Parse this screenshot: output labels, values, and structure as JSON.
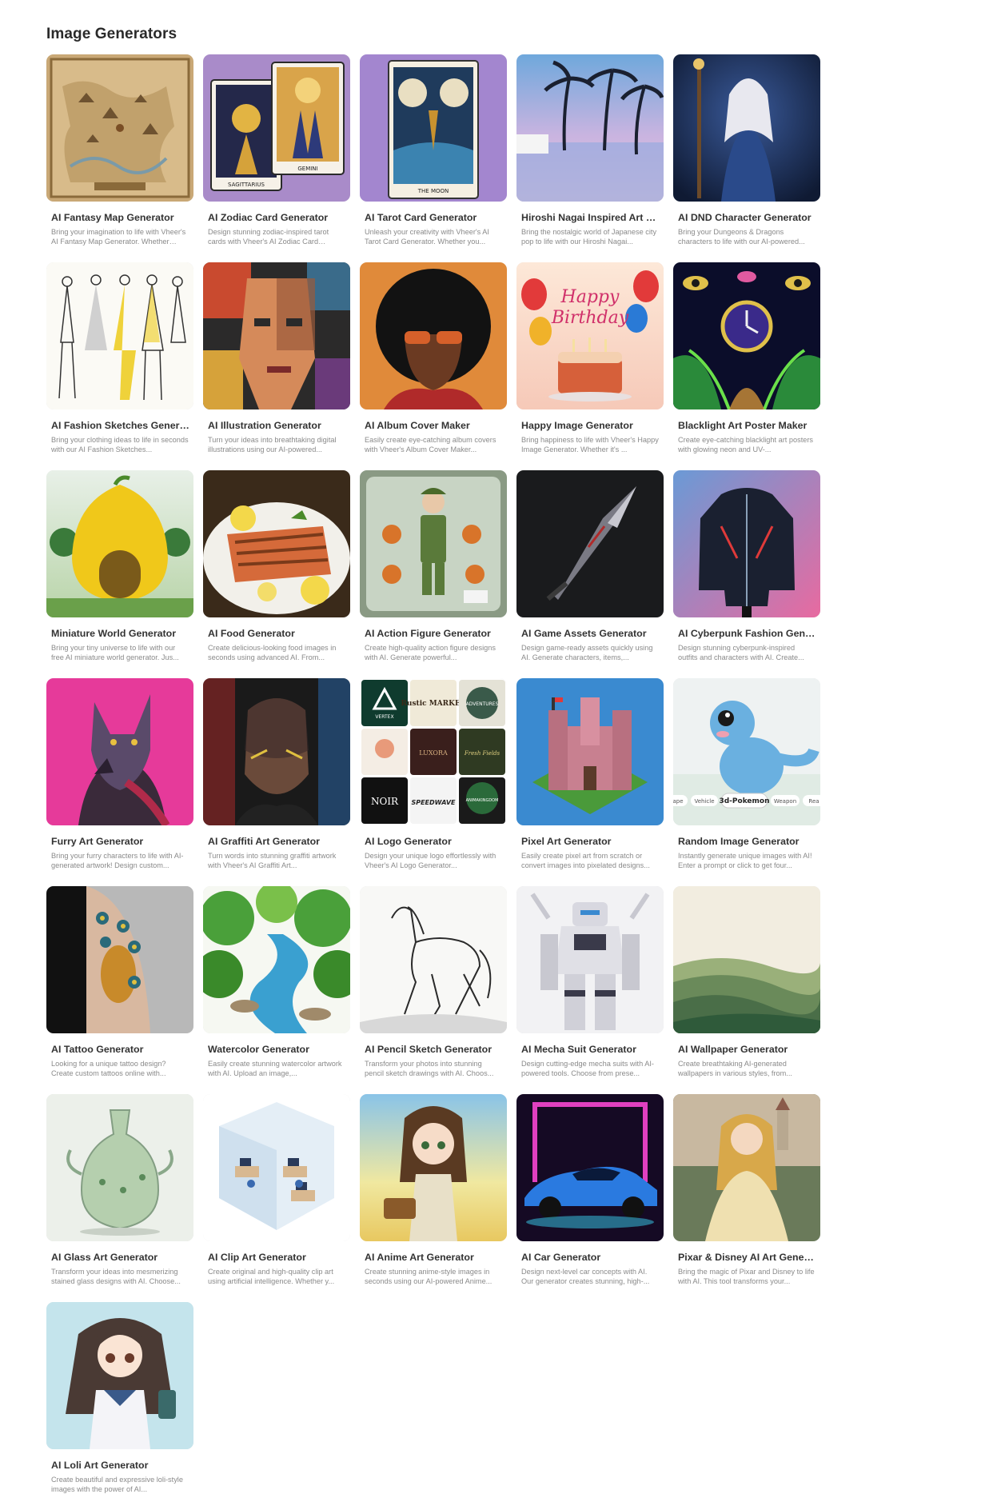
{
  "section": {
    "title": "Image Generators"
  },
  "cards": [
    {
      "title": "AI Fantasy Map Generator",
      "desc": "Bring your imagination to life with Vheer's AI Fantasy Map Generator. Whether you...",
      "icon": "fantasy-map-thumbnail"
    },
    {
      "title": "AI Zodiac Card Generator",
      "desc": "Design stunning zodiac-inspired tarot cards with Vheer's AI Zodiac Card Generator...",
      "icon": "zodiac-card-thumbnail"
    },
    {
      "title": "AI Tarot Card Generator",
      "desc": "Unleash your creativity with Vheer's AI Tarot Card Generator. Whether you...",
      "icon": "tarot-card-thumbnail"
    },
    {
      "title": "Hiroshi Nagai Inspired Art Generator",
      "desc": "Bring the nostalgic world of Japanese city pop to life with our Hiroshi Nagai...",
      "icon": "palm-beach-thumbnail"
    },
    {
      "title": "AI DND Character Generator",
      "desc": "Bring your Dungeons & Dragons characters to life with our AI-powered...",
      "icon": "wizard-thumbnail"
    },
    {
      "title": "AI Fashion Sketches Generator",
      "desc": "Bring your clothing ideas to life in seconds with our AI Fashion Sketches...",
      "icon": "fashion-sketch-thumbnail"
    },
    {
      "title": "AI Illustration Generator",
      "desc": "Turn your ideas into breathtaking digital illustrations using our AI-powered...",
      "icon": "cubist-portrait-thumbnail"
    },
    {
      "title": "AI Album Cover Maker",
      "desc": "Easily create eye-catching album covers with Vheer's Album Cover Maker...",
      "icon": "album-portrait-thumbnail"
    },
    {
      "title": "Happy Image Generator",
      "desc": "Bring happiness to life with Vheer's Happy Image Generator. Whether it's ...",
      "icon": "birthday-cake-thumbnail"
    },
    {
      "title": "Blacklight Art Poster Maker",
      "desc": "Create eye-catching blacklight art posters with glowing neon and UV-...",
      "icon": "blacklight-clock-thumbnail"
    },
    {
      "title": "Miniature World Generator",
      "desc": "Bring your tiny universe to life with our free AI miniature world generator. Jus...",
      "icon": "lemon-house-thumbnail"
    },
    {
      "title": "AI Food Generator",
      "desc": "Create delicious-looking food images in seconds using advanced AI. From...",
      "icon": "salmon-dish-thumbnail"
    },
    {
      "title": "AI Action Figure Generator",
      "desc": "Create high-quality action figure designs with AI. Generate powerful...",
      "icon": "action-figure-thumbnail"
    },
    {
      "title": "AI Game Assets Generator",
      "desc": "Design game-ready assets quickly using AI. Generate characters, items,...",
      "icon": "sword-thumbnail"
    },
    {
      "title": "AI Cyberpunk Fashion Generator",
      "desc": "Design stunning cyberpunk-inspired outfits and characters with AI. Create...",
      "icon": "cyber-jacket-thumbnail"
    },
    {
      "title": "Furry Art Generator",
      "desc": "Bring your furry characters to life with AI-generated artwork! Design custom...",
      "icon": "wolf-thumbnail"
    },
    {
      "title": "AI Graffiti Art Generator",
      "desc": "Turn words into stunning graffiti artwork with Vheer's AI Graffiti Art...",
      "icon": "graffiti-portrait-thumbnail"
    },
    {
      "title": "AI Logo Generator",
      "desc": "Design your unique logo effortlessly with Vheer's AI Logo Generator...",
      "icon": "logo-grid-thumbnail"
    },
    {
      "title": "Pixel Art Generator",
      "desc": "Easily create pixel art from scratch or convert images into pixelated designs...",
      "icon": "pixel-castle-thumbnail"
    },
    {
      "title": "Random Image Generator",
      "desc": "Instantly generate unique images with AI! Enter a prompt or click to get four...",
      "icon": "dino-thumbnail"
    },
    {
      "title": "AI Tattoo Generator",
      "desc": "Looking for a unique tattoo design? Create custom tattoos online with...",
      "icon": "peacock-tattoo-thumbnail"
    },
    {
      "title": "Watercolor Generator",
      "desc": "Easily create stunning watercolor artwork with AI. Upload an image,...",
      "icon": "river-watercolor-thumbnail"
    },
    {
      "title": "AI Pencil Sketch Generator",
      "desc": "Transform your photos into stunning pencil sketch drawings with AI. Choos...",
      "icon": "horse-sketch-thumbnail"
    },
    {
      "title": "AI Mecha Suit Generator",
      "desc": "Design cutting-edge mecha suits with AI-powered tools. Choose from prese...",
      "icon": "mecha-thumbnail"
    },
    {
      "title": "AI Wallpaper Generator",
      "desc": "Create breathtaking AI-generated wallpapers in various styles, from...",
      "icon": "hills-thumbnail"
    },
    {
      "title": "AI Glass Art Generator",
      "desc": "Transform your ideas into mesmerizing stained glass designs with AI. Choose...",
      "icon": "glass-vase-thumbnail"
    },
    {
      "title": "AI Clip Art Generator",
      "desc": "Create original and high-quality clip art using artificial intelligence. Whether y...",
      "icon": "office-clipart-thumbnail"
    },
    {
      "title": "AI Anime Art Generator",
      "desc": "Create stunning anime-style images in seconds using our AI-powered Anime...",
      "icon": "anime-girl-thumbnail"
    },
    {
      "title": "AI Car Generator",
      "desc": "Design next-level car concepts with AI. Our generator creates stunning, high-...",
      "icon": "neon-car-thumbnail"
    },
    {
      "title": "Pixar & Disney AI Art Generator",
      "desc": "Bring the magic of Pixar and Disney to life with AI. This tool transforms your...",
      "icon": "princess-thumbnail"
    },
    {
      "title": "AI Loli Art Generator",
      "desc": "Create beautiful and expressive loli-style images with the power of AI...",
      "icon": "schoolgirl-thumbnail"
    }
  ],
  "tarot_labels": {
    "sagittarius": "SAGITTARIUS",
    "gemini": "GEMINI",
    "moon": "THE MOON"
  },
  "birthday_text": {
    "line1": "Happy",
    "line2": "Birthday"
  },
  "logo_tiles": [
    "VERTEX",
    "Rustic MARKET",
    "ADVENTURES",
    "",
    "LUXORA",
    "Fresh Fields",
    "NOIR",
    "SPEEDWAVE",
    "ANIMAKINGDOM"
  ],
  "dino_chips": [
    "ape",
    "Vehicle",
    "3d-Pokemon",
    "Weapon",
    "Rea"
  ]
}
